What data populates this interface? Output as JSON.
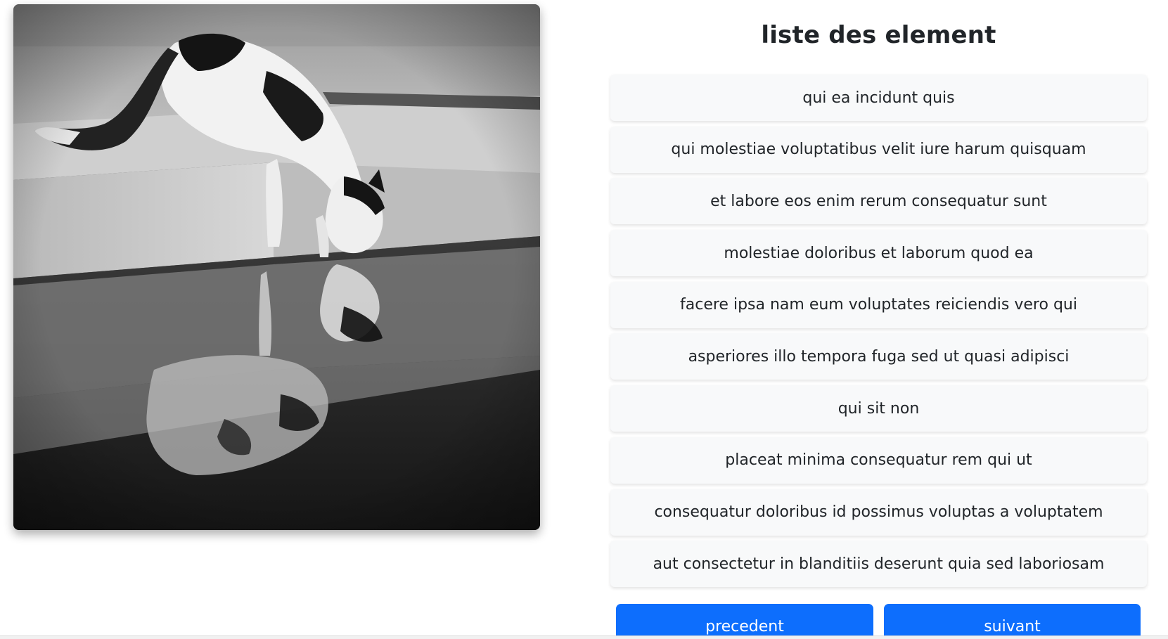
{
  "photo": {
    "subject": "cat drinking water reflection photo"
  },
  "list": {
    "title": "liste des element",
    "items": [
      "qui ea incidunt quis",
      "qui molestiae voluptatibus velit iure harum quisquam",
      "et labore eos enim rerum consequatur sunt",
      "molestiae doloribus et laborum quod ea",
      "facere ipsa nam eum voluptates reiciendis vero qui",
      "asperiores illo tempora fuga sed ut quasi adipisci",
      "qui sit non",
      "placeat minima consequatur rem qui ut",
      "consequatur doloribus id possimus voluptas a voluptatem",
      "aut consectetur in blanditiis deserunt quia sed laboriosam"
    ]
  },
  "pagination": {
    "prev_label": "precedent",
    "next_label": "suivant"
  },
  "colors": {
    "primary": "#0d6efd",
    "item_bg": "#f8f9fa",
    "text": "#212529"
  }
}
